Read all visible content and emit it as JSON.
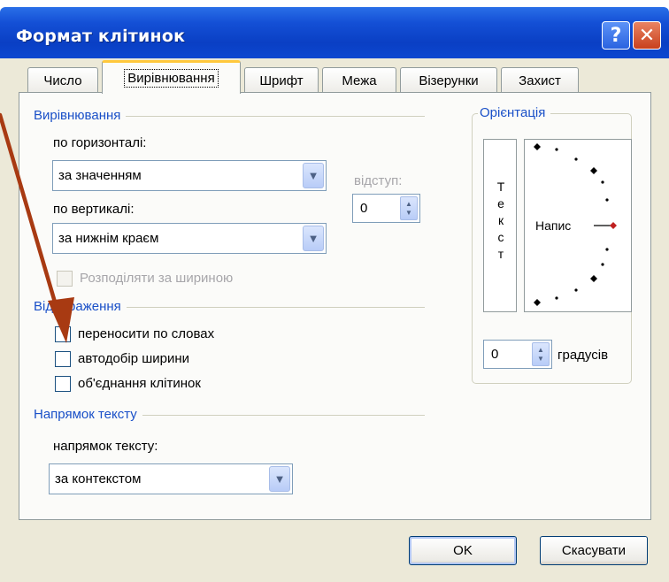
{
  "window": {
    "title": "Формат клітинок",
    "help_glyph": "?",
    "close_glyph": "✕"
  },
  "tabs": [
    {
      "label": "Число"
    },
    {
      "label": "Вирівнювання",
      "active": true
    },
    {
      "label": "Шрифт"
    },
    {
      "label": "Межа"
    },
    {
      "label": "Візерунки"
    },
    {
      "label": "Захист"
    }
  ],
  "alignment": {
    "group_title": "Вирівнювання",
    "horizontal_label": "по горизонталі:",
    "horizontal_value": "за значенням",
    "vertical_label": "по вертикалі:",
    "vertical_value": "за нижнім краєм",
    "indent_label": "відступ:",
    "indent_value": "0",
    "distribute_label": "Розподіляти за шириною"
  },
  "display": {
    "group_title": "Відображення",
    "wrap_text": "переносити по словах",
    "shrink_to_fit": "автодобір ширини",
    "merge_cells": "об'єднання клітинок"
  },
  "direction": {
    "group_title": "Напрямок тексту",
    "label": "напрямок тексту:",
    "value": "за контекстом"
  },
  "orientation": {
    "group_title": "Орієнтація",
    "vertical_text": [
      "Т",
      "е",
      "к",
      "с",
      "т"
    ],
    "dial_label": "Напис",
    "degrees_value": "0",
    "degrees_label": "градусів"
  },
  "buttons": {
    "ok": "OK",
    "cancel": "Скасувати"
  },
  "colors": {
    "title_bar": "#0a3fc4",
    "group_title": "#1a50c8",
    "arrow": "#a83a12"
  }
}
